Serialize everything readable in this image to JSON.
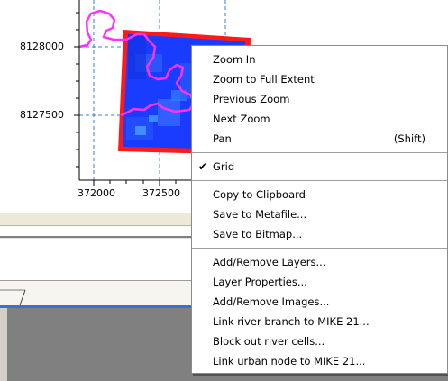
{
  "map": {
    "y_ticks": [
      "8128000",
      "8127500"
    ],
    "x_ticks": [
      "372000",
      "372500"
    ],
    "colors": {
      "grid": "#2e7ff0",
      "raster": "#1a3cff",
      "extent_border": "#ff1a1a",
      "boundary_line": "#ff33ff"
    }
  },
  "context_menu": {
    "groups": [
      [
        {
          "label": "Zoom In"
        },
        {
          "label": "Zoom to Full Extent"
        },
        {
          "label": "Previous Zoom"
        },
        {
          "label": "Next Zoom"
        },
        {
          "label": "Pan",
          "shortcut": "(Shift)"
        }
      ],
      [
        {
          "label": "Grid",
          "checked": true
        }
      ],
      [
        {
          "label": "Copy to Clipboard"
        },
        {
          "label": "Save to Metafile..."
        },
        {
          "label": "Save to Bitmap..."
        }
      ],
      [
        {
          "label": "Add/Remove Layers..."
        },
        {
          "label": "Layer Properties..."
        },
        {
          "label": "Add/Remove Images..."
        },
        {
          "label": "Link river branch to MIKE 21..."
        },
        {
          "label": "Block out river cells..."
        },
        {
          "label": "Link urban node to MIKE 21..."
        }
      ]
    ],
    "check_icon": "checkmark-icon"
  }
}
